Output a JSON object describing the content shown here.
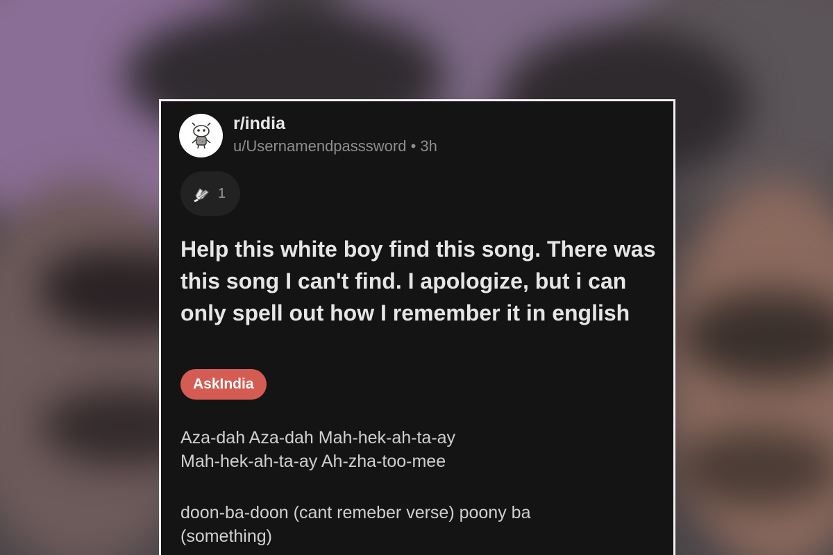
{
  "post": {
    "subreddit": "r/india",
    "author_time": "u/Usernamendpasssword • 3h",
    "award_count": "1",
    "title": "Help this white boy find this song. There was this song I can't find. I apologize, but i can only spell out how I remember it in english",
    "flair": "AskIndia",
    "body": {
      "line1": "Aza-dah Aza-dah Mah-hek-ah-ta-ay",
      "line2": "Mah-hek-ah-ta-ay Ah-zha-too-mee",
      "line3": "doon-ba-doon (cant remeber verse) poony ba",
      "line4": "(something)"
    }
  },
  "colors": {
    "card_background": "#141414",
    "card_border": "#f2f2f2",
    "flair": "#d45c53"
  },
  "icons": {
    "avatar": "snoo-avatar-icon",
    "award": "award-hands-icon"
  }
}
